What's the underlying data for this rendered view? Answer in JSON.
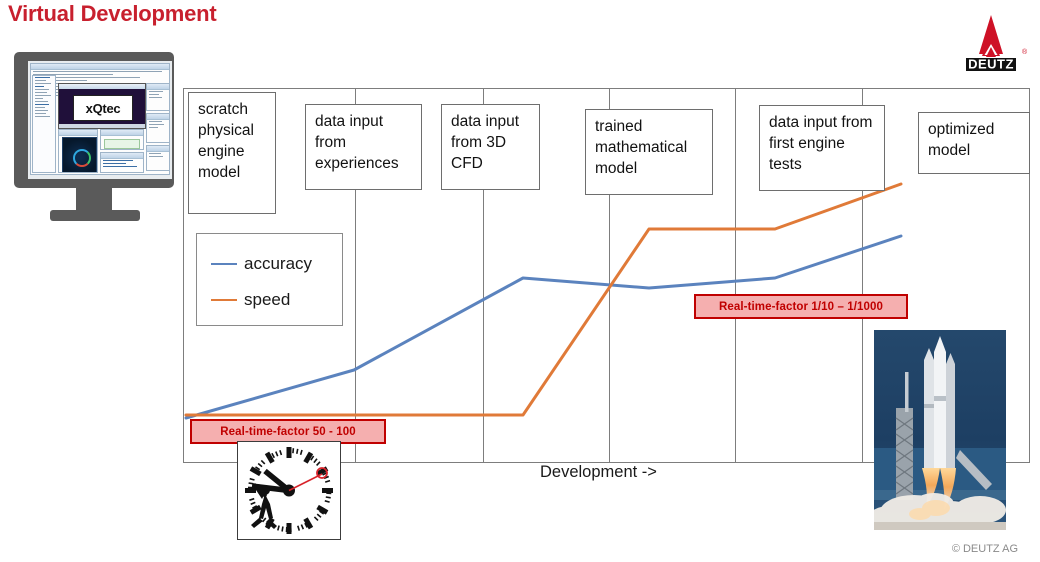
{
  "title": "Virtual Development",
  "brand": {
    "logo_name": "DEUTZ",
    "registered_mark": "®",
    "copyright": "© DEUTZ AG"
  },
  "monitor": {
    "screen_label": "xQtec"
  },
  "chart_data": {
    "type": "line",
    "title": "Virtual Development",
    "xlabel": "Development ->",
    "ylabel": "",
    "grid": false,
    "legend_position": "upper-left-inside",
    "x_axis_caption": "Development ->",
    "categories": [
      "scratch physical engine model",
      "data input from experiences",
      "data input from 3D CFD",
      "trained mathematical model",
      "data input from first engine tests",
      "optimized model"
    ],
    "x": [
      0,
      1,
      2,
      3,
      4,
      5
    ],
    "series": [
      {
        "name": "accuracy",
        "color": "#5B83BE",
        "values": [
          4,
          31,
          56,
          50,
          53,
          72
        ]
      },
      {
        "name": "speed",
        "color": "#E07A38",
        "values": [
          5,
          5,
          5,
          67,
          67,
          84
        ]
      }
    ],
    "ylim": [
      0,
      100
    ],
    "annotations": [
      {
        "text": "Real-time-factor  50 - 100",
        "near_series": "speed",
        "x_position": 0.05
      },
      {
        "text": "Real-time-factor  1/10 – 1/1000",
        "near_series": "speed",
        "x_position": 2.9
      }
    ]
  },
  "stages": [
    {
      "id": "stage-scratch",
      "text": "scratch physical engine model"
    },
    {
      "id": "stage-experiences",
      "text": "data input from experiences"
    },
    {
      "id": "stage-3dcfd",
      "text": "data input from 3D CFD"
    },
    {
      "id": "stage-trained-model",
      "text": "trained mathematical model"
    },
    {
      "id": "stage-engine-tests",
      "text": "data input from first engine tests"
    },
    {
      "id": "stage-optimized",
      "text": "optimized model"
    }
  ],
  "legend": {
    "items": [
      {
        "label": "accuracy",
        "color": "#5B83BE"
      },
      {
        "label": "speed",
        "color": "#E07A38"
      }
    ]
  },
  "callouts": [
    {
      "id": "callout-left",
      "text": "Real-time-factor  50 - 100"
    },
    {
      "id": "callout-right",
      "text": "Real-time-factor  1/10 – 1/1000"
    }
  ],
  "axis_caption": "Development ->",
  "colors": {
    "title_red": "#C8202E",
    "accuracy_blue": "#5B83BE",
    "speed_orange": "#E07A38",
    "callout_border": "#C00000",
    "callout_fill": "#F5AFAF",
    "frame_gray": "#7D7D7D"
  },
  "icons": {
    "clock": "swiss-clock-icon",
    "rocket": "rocket-launch-photo",
    "monitor": "desktop-monitor-icon",
    "logo": "deutz-logo-icon"
  }
}
